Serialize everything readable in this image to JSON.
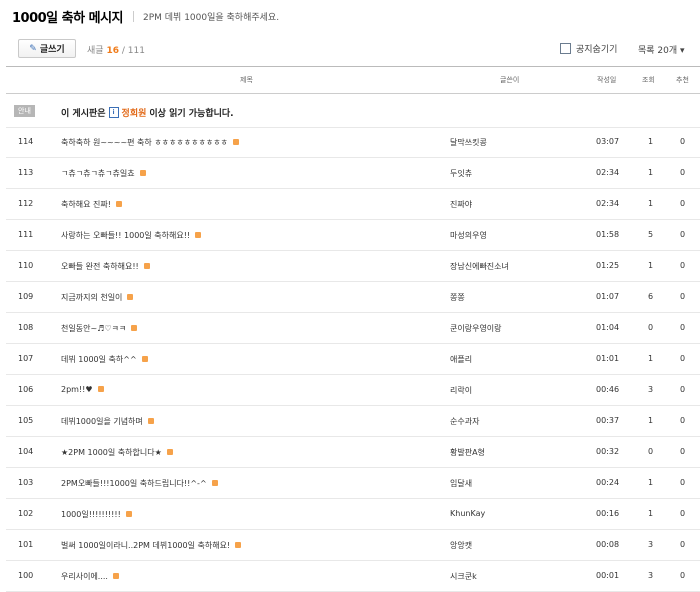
{
  "header": {
    "title": "1000일 축하 메시지",
    "description": "2PM 데뷔 1000일을 축하해주세요."
  },
  "toolbar": {
    "write_label": "글쓰기",
    "new_label": "새글",
    "new_count": "16",
    "total": "/ 111",
    "notice_hide_label": "공지숨기기",
    "view_count_label": "목록 20개 ▾"
  },
  "columns": {
    "title": "제목",
    "author": "글쓴이",
    "date": "작성일",
    "views": "조회",
    "likes": "추천"
  },
  "notice": {
    "tag": "안내",
    "prefix": "이 게시판은",
    "grade": "정회원",
    "suffix": "이상 읽기 가능합니다."
  },
  "posts": [
    {
      "num": "114",
      "title": "축하축하 원~~~~편 축하 ㅎㅎㅎㅎㅎㅎㅎㅎㅎㅎ",
      "author": "달막쓰킷콩",
      "date": "03:07",
      "views": "1",
      "likes": "0"
    },
    {
      "num": "113",
      "title": "ㄱ츄ㄱ츄ㄱ츄ㄱ츄일쵸",
      "author": "두잇츄",
      "date": "02:34",
      "views": "1",
      "likes": "0"
    },
    {
      "num": "112",
      "title": "축하해요 진짜!",
      "author": "진짜야",
      "date": "02:34",
      "views": "1",
      "likes": "0"
    },
    {
      "num": "111",
      "title": "사랑하는 오빠들!! 1000일 축하해요!!",
      "author": "마성의우영",
      "date": "01:58",
      "views": "5",
      "likes": "0"
    },
    {
      "num": "110",
      "title": "오빠들 완전 축하해요!!",
      "author": "장남신에빠진소녀",
      "date": "01:25",
      "views": "1",
      "likes": "0"
    },
    {
      "num": "109",
      "title": "지금까지의 천일이",
      "author": "쫑쫑",
      "date": "01:07",
      "views": "6",
      "likes": "0"
    },
    {
      "num": "108",
      "title": "천일동안~♬♡ㅋㅋ",
      "author": "쿤이랑우영이랑",
      "date": "01:04",
      "views": "0",
      "likes": "0"
    },
    {
      "num": "107",
      "title": "데뷔 1000일 축하^^",
      "author": "애플리",
      "date": "01:01",
      "views": "1",
      "likes": "0"
    },
    {
      "num": "106",
      "title": "2pm!!♥",
      "author": "리락이",
      "date": "00:46",
      "views": "3",
      "likes": "0"
    },
    {
      "num": "105",
      "title": "데뷔1000일을 기념하며",
      "author": "순수과자",
      "date": "00:37",
      "views": "1",
      "likes": "0"
    },
    {
      "num": "104",
      "title": "★2PM 1000일 축하합니다★",
      "author": "황발판A형",
      "date": "00:32",
      "views": "0",
      "likes": "0"
    },
    {
      "num": "103",
      "title": "2PM오빠들!!!1000일 축하드립니다!!^-^",
      "author": "임달새",
      "date": "00:24",
      "views": "1",
      "likes": "0"
    },
    {
      "num": "102",
      "title": "1000일!!!!!!!!!!",
      "author": "KhunKay",
      "date": "00:16",
      "views": "1",
      "likes": "0"
    },
    {
      "num": "101",
      "title": "벌써 1000일이라니..2PM 데뷔1000일 축하해요!",
      "author": "앙앙캣",
      "date": "00:08",
      "views": "3",
      "likes": "0"
    },
    {
      "num": "100",
      "title": "우리사이에....",
      "author": "시크쿤k",
      "date": "00:01",
      "views": "3",
      "likes": "0"
    }
  ]
}
